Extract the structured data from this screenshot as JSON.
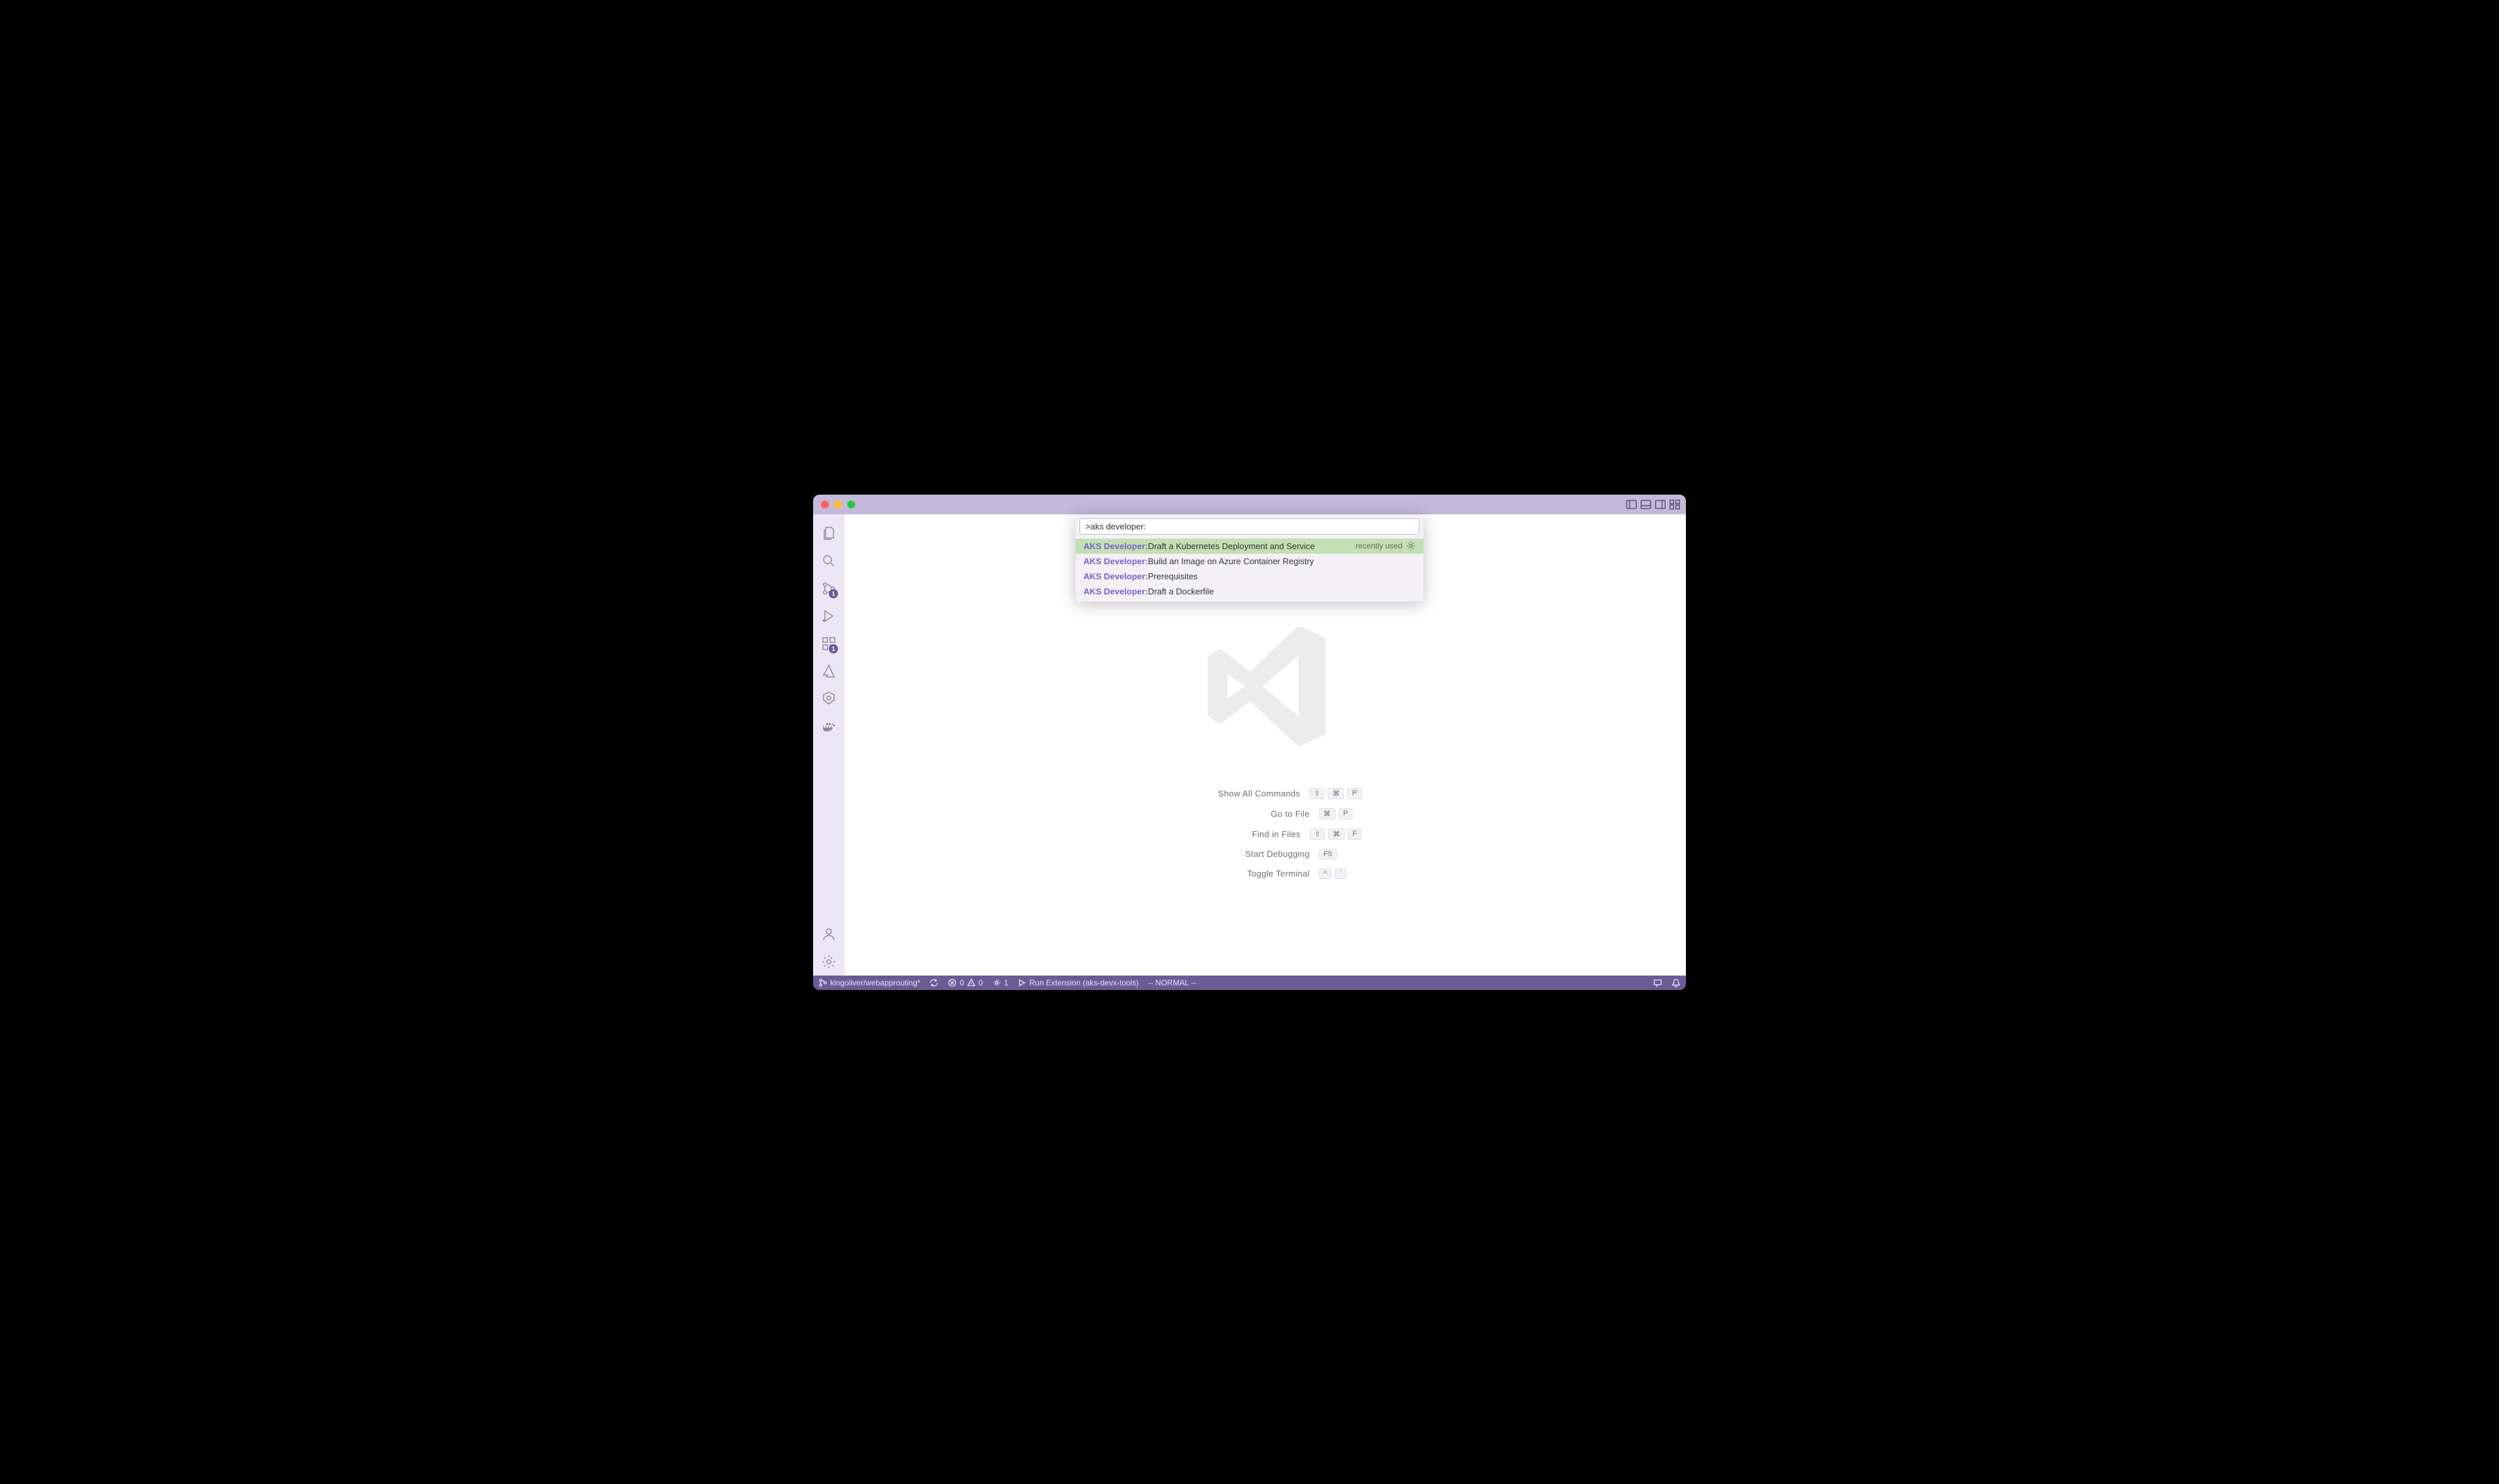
{
  "palette": {
    "input_value": ">aks developer: ",
    "items": [
      {
        "prefix": "AKS Developer:",
        "text": " Draft a Kubernetes Deployment and Service",
        "right": "recently used",
        "selected": true,
        "gear": true
      },
      {
        "prefix": "AKS Developer:",
        "text": " Build an Image on Azure Container Registry",
        "right": "",
        "selected": false,
        "gear": false
      },
      {
        "prefix": "AKS Developer:",
        "text": " Prerequisites",
        "right": "",
        "selected": false,
        "gear": false
      },
      {
        "prefix": "AKS Developer:",
        "text": " Draft a Dockerfile",
        "right": "",
        "selected": false,
        "gear": false
      }
    ]
  },
  "activity": {
    "scm_badge": "1",
    "extensions_badge": "1"
  },
  "shortcuts": [
    {
      "label": "Show All Commands",
      "keys": [
        "⇧",
        "⌘",
        "P"
      ]
    },
    {
      "label": "Go to File",
      "keys": [
        "⌘",
        "P"
      ]
    },
    {
      "label": "Find in Files",
      "keys": [
        "⇧",
        "⌘",
        "F"
      ]
    },
    {
      "label": "Start Debugging",
      "keys": [
        "F5"
      ]
    },
    {
      "label": "Toggle Terminal",
      "keys": [
        "^",
        "`"
      ]
    }
  ],
  "status": {
    "branch": "kingoliver/webapprouting*",
    "errors": "0",
    "warnings": "0",
    "ports": "1",
    "run": "Run Extension (aks-devx-tools)",
    "mode": "-- NORMAL --"
  }
}
